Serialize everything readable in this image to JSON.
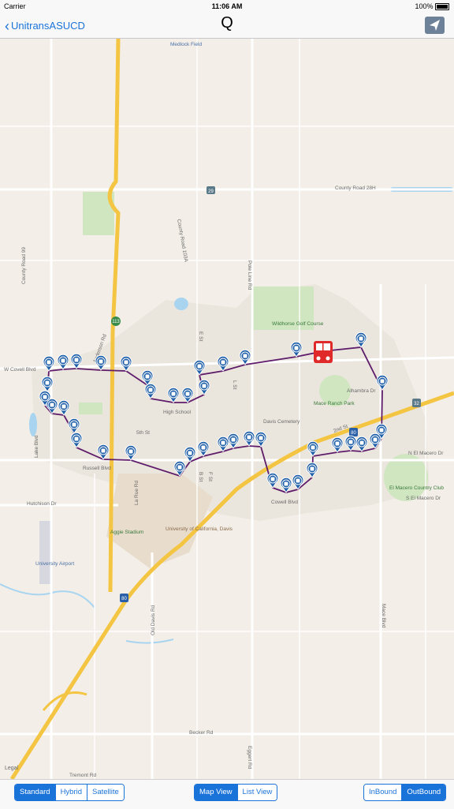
{
  "status": {
    "carrier": "Carrier",
    "time": "11:06 AM",
    "battery": "100%"
  },
  "nav": {
    "back_label": "UnitransASUCD",
    "title": "Q"
  },
  "map": {
    "legal": "Legal",
    "place_labels": [
      "Medlock Field",
      "County Road 28H",
      "County Road 99",
      "County Road 103A",
      "Pole Line Rd",
      "Wildhorse Golf Course",
      "W Covell Blvd",
      "Lake Blvd",
      "Anderson Rd",
      "High School",
      "Davis Cemetery",
      "Mace Ranch Park",
      "Alhambra Dr",
      "5th St",
      "2nd St",
      "Cowell Blvd",
      "N El Macero Dr",
      "El Macero Country Club",
      "S El Macero Dr",
      "Hutchison Dr",
      "La Rue Rd",
      "Aggie Stadium",
      "University of California, Davis",
      "University Airport",
      "Old Davis Rd",
      "Mace Blvd",
      "Becker Rd",
      "Tremont Rd",
      "Eggert Rd",
      "E St",
      "L St",
      "F St",
      "B St",
      "Russell Blvd"
    ],
    "route_shields": [
      "29",
      "113",
      "80",
      "32",
      "80"
    ],
    "stop_count": 43
  },
  "bottom": {
    "map_type": [
      "Standard",
      "Hybrid",
      "Satellite"
    ],
    "view": [
      "Map View",
      "List View"
    ],
    "direction": [
      "InBound",
      "OutBound"
    ]
  },
  "colors": {
    "accent": "#1a73d9",
    "route": "#5e1c6b",
    "stop": "#1f5fa8",
    "bus": "#e02a2a"
  }
}
